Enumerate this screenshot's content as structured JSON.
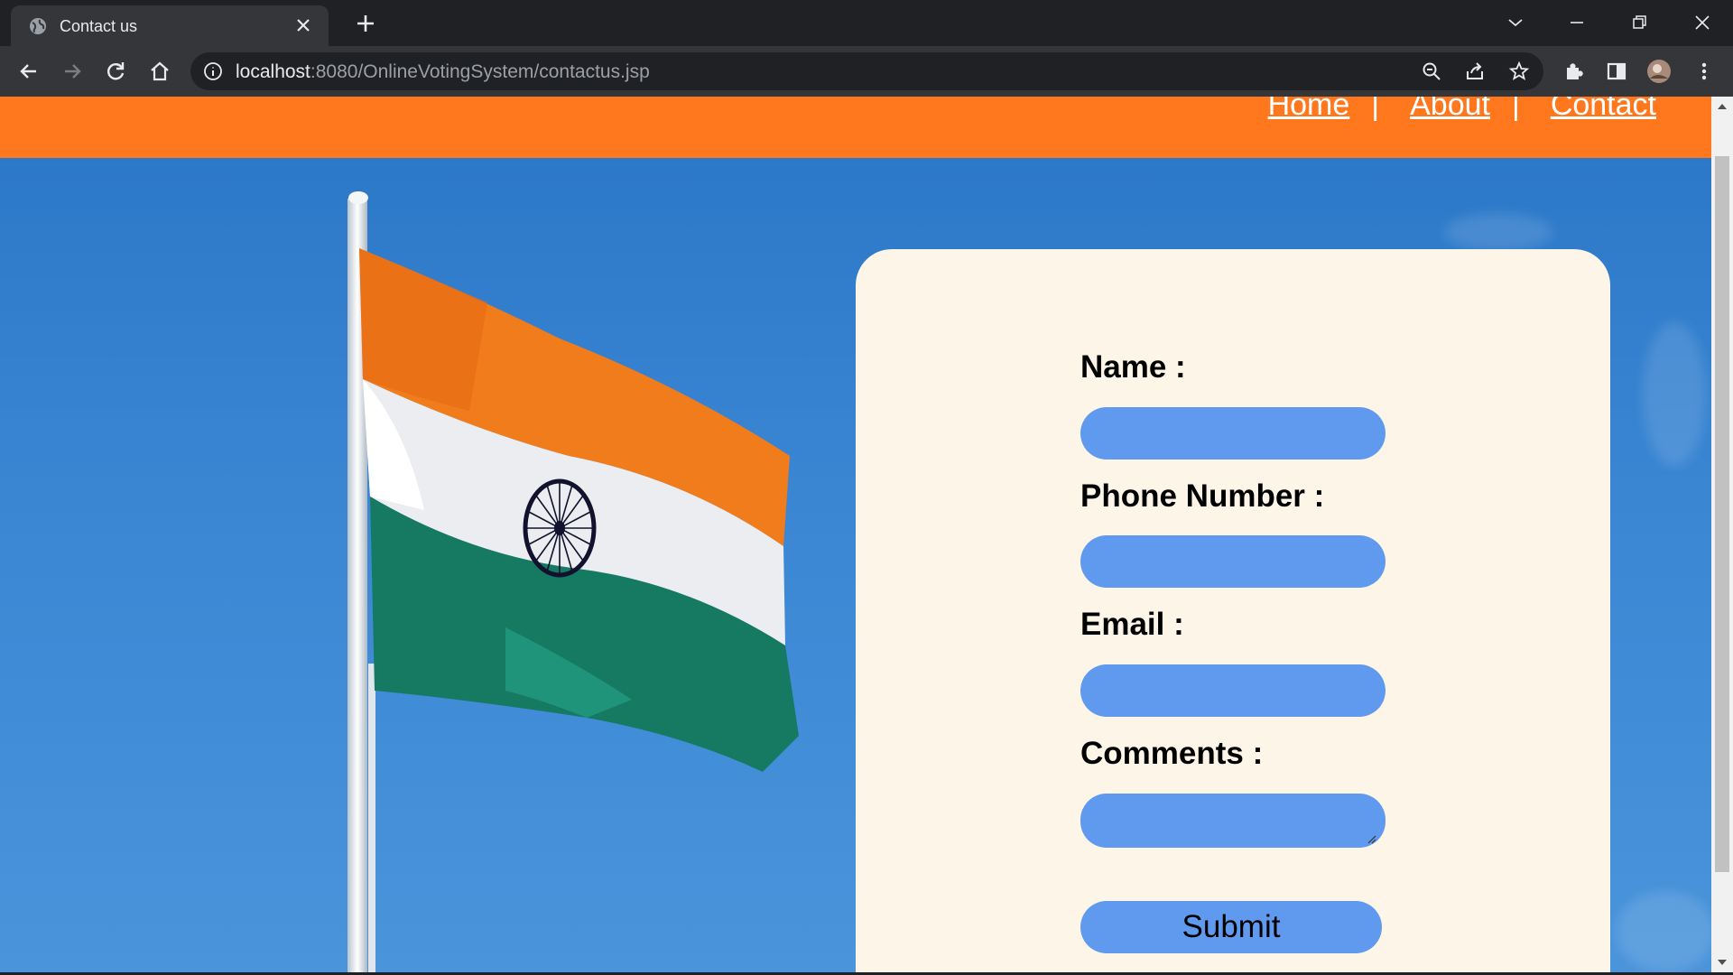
{
  "browser": {
    "tab_title": "Contact us",
    "url_host": "localhost",
    "url_rest": ":8080/OnlineVotingSystem/contactus.jsp"
  },
  "nav": {
    "home": "Home",
    "about": "About",
    "contact": "Contact",
    "separator": "|"
  },
  "form": {
    "name_label": "Name :",
    "phone_label": "Phone Number :",
    "email_label": "Email :",
    "comments_label": "Comments :",
    "submit_label": "Submit"
  },
  "colors": {
    "header": "#ff781e",
    "sky": "#2a76c6",
    "card": "#fdf5e8",
    "input": "#5f9aef"
  }
}
